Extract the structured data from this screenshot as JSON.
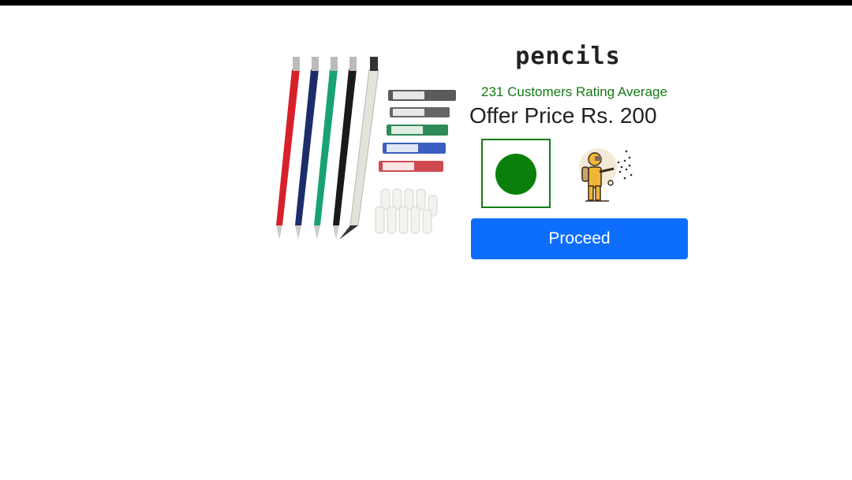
{
  "product": {
    "title": "pencils",
    "rating_text": "231 Customers Rating Average",
    "offer_price": "Offer Price Rs. 200"
  },
  "options": {
    "selected_color": "#0a800a",
    "border_color": "#137a13"
  },
  "actions": {
    "proceed_label": "Proceed"
  },
  "colors": {
    "accent": "#0d6efd",
    "rating_green": "#137a13"
  },
  "icons": {
    "service": "pest-control-worker-icon"
  }
}
